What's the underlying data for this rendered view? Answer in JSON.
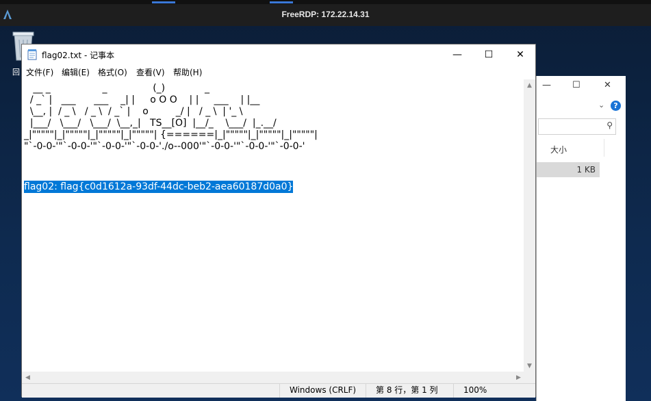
{
  "rdp": {
    "title": "FreeRDP: 172.22.14.31"
  },
  "desktop": {
    "icon_label_char": "回"
  },
  "notepad": {
    "title": "flag02.txt - 记事本",
    "menu": [
      "文件(F)",
      "编辑(E)",
      "格式(O)",
      "查看(V)",
      "帮助(H)"
    ],
    "content_ascii": "   __ _                 _               (_)             _\n  / _` |   ___      ___    _| |     o O O    | |     ___    | |__\n  \\__, |  / _ \\   / _ \\  / _` |    o         _/ |   / _ \\  | '_ \\\n  |___/   \\___/   \\___/  \\__,_|   TS__[O]  |__/_    \\___/  |_.__/\n_|\"\"\"\"\"|_|\"\"\"\"\"|_|\"\"\"\"\"|_|\"\"\"\"\"| {======|_|\"\"\"\"\"|_|\"\"\"\"\"|_|\"\"\"\"\"|\n\"`-0-0-'\"`-0-0-'\"`-0-0-'\"`-0-0-'./o--000'\"`-0-0-'\"`-0-0-'\"`-0-0-'",
    "flag_line": "flag02: flag{c0d1612a-93df-44dc-beb2-aea60187d0a0}",
    "status": {
      "encoding": "Windows (CRLF)",
      "position": "第 8 行，第 1 列",
      "zoom": "100%"
    }
  },
  "explorer": {
    "column_size": "大小",
    "file_size": "1 KB"
  },
  "colors": {
    "selection": "#0078d7",
    "rdp_bar": "#1e1e1e"
  }
}
